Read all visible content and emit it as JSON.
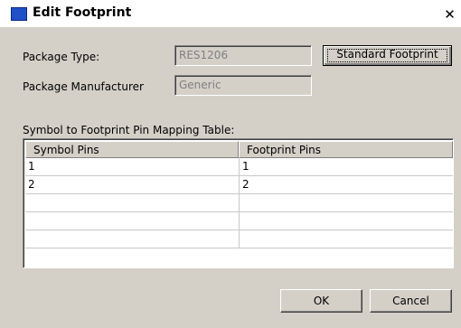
{
  "window": {
    "title": "Edit Footprint",
    "close_glyph": "✕"
  },
  "form": {
    "package_type_label": "Package Type:",
    "package_type_value": "RES1206",
    "package_manufacturer_label": "Package Manufacturer",
    "package_manufacturer_value": "Generic",
    "standard_footprint_label": "Standard Footprint"
  },
  "mapping": {
    "section_label": "Symbol to Footprint Pin Mapping Table:",
    "columns": [
      "Symbol Pins",
      "Footprint Pins"
    ],
    "rows": [
      [
        "1",
        "1"
      ],
      [
        "2",
        "2"
      ],
      [
        "",
        ""
      ],
      [
        "",
        ""
      ],
      [
        "",
        ""
      ]
    ]
  },
  "buttons": {
    "ok_label": "OK",
    "cancel_label": "Cancel"
  },
  "icons": {
    "title_icon": "window-icon",
    "close_icon": "close-icon"
  }
}
